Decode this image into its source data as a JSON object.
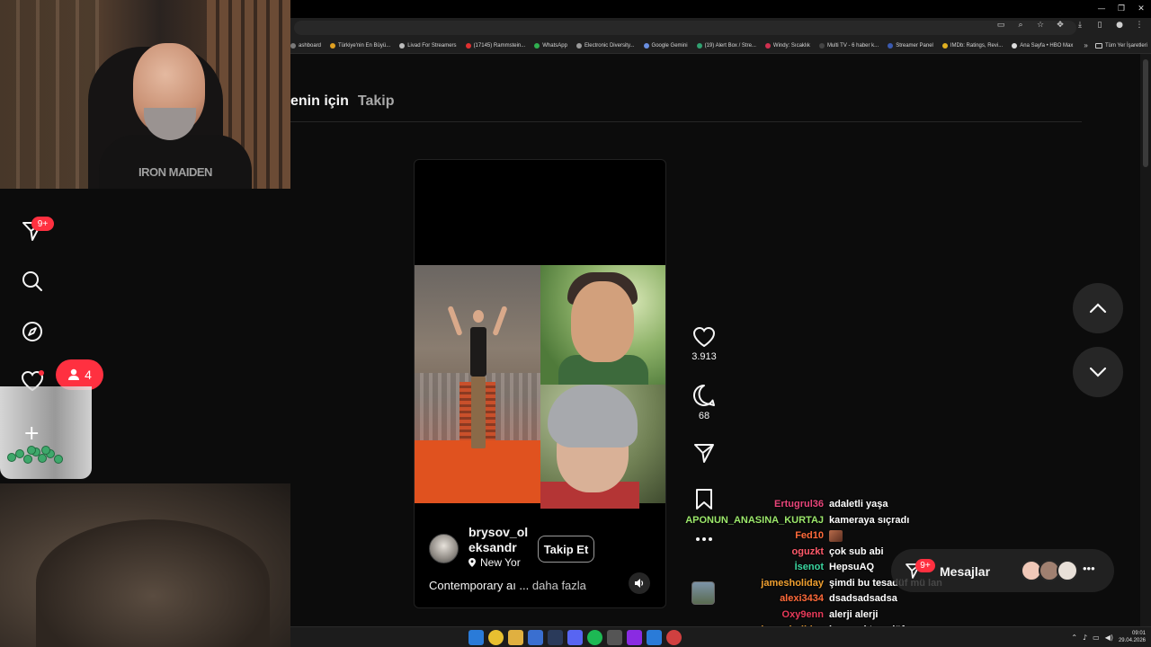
{
  "browser": {
    "bookmarks": [
      {
        "label": "ashboard",
        "color": "#7a7a7a"
      },
      {
        "label": "Türkiye'nin En Büyü...",
        "color": "#e0a020"
      },
      {
        "label": "Livad For Streamers",
        "color": "#bbbbbb"
      },
      {
        "label": "(17145) Rammstein...",
        "color": "#e03030"
      },
      {
        "label": "WhatsApp",
        "color": "#30b050"
      },
      {
        "label": "Electronic Diversity...",
        "color": "#9a9a9a"
      },
      {
        "label": "Google Gemini",
        "color": "#6a8fe0"
      },
      {
        "label": "(19) Alert Box / Stre...",
        "color": "#30a070"
      },
      {
        "label": "Windy: Sıcaklık",
        "color": "#d03050"
      },
      {
        "label": "Multi TV - 6 haber k...",
        "color": "#444444"
      },
      {
        "label": "Streamer Panel",
        "color": "#3a5ab0"
      },
      {
        "label": "IMDb: Ratings, Revi...",
        "color": "#e0b020"
      },
      {
        "label": "Ana Sayfa • HBO Max",
        "color": "#dddddd"
      }
    ],
    "bookmarks_more": "»",
    "bookmarks_folder": "Tüm Yer İşaretleri"
  },
  "feed": {
    "tab_for_you": "enin için",
    "tab_following": "Takip"
  },
  "reel": {
    "username": "brysov_oleksandr",
    "location": "New Yor",
    "follow_label": "Takip Et",
    "caption": "Contemporary aı ...",
    "caption_more": "daha fazla",
    "likes": "3.913",
    "comments": "68"
  },
  "sidebar": {
    "notif_badge": "9+",
    "activity_count": "4"
  },
  "webcam": {
    "shirt_text": "IRON MAIDEN"
  },
  "chat": [
    {
      "user": "Ertugrul36",
      "color": "#e8457a",
      "msg": "adaletli yaşa"
    },
    {
      "user": "APONUN_ANASINA_KURTAJ",
      "color": "#9ce86b",
      "msg": "kameraya sıçradı"
    },
    {
      "user": "Fed10",
      "color": "#ff6a3a",
      "msg": ""
    },
    {
      "user": "oguzkt",
      "color": "#ff5a6a",
      "msg": "çok sub abi"
    },
    {
      "user": "İsenot",
      "color": "#3ad6a0",
      "msg": "HepsuAQ"
    },
    {
      "user": "jamesholiday",
      "color": "#f0a030",
      "msg": "şimdi bu tesadüf mü lan"
    },
    {
      "user": "alexi3434",
      "color": "#ff6a3a",
      "msg": "dsadsadsadsa"
    },
    {
      "user": "Oxy9enn",
      "color": "#e83a5a",
      "msg": "alerji alerji"
    },
    {
      "user": "jamesholiday",
      "color": "#f0a030",
      "msg": "bu nasıl tesadüf"
    }
  ],
  "messages": {
    "label": "Mesajlar",
    "badge": "9+"
  },
  "taskbar": {
    "time": "09:01",
    "date": "29.04.2026"
  }
}
